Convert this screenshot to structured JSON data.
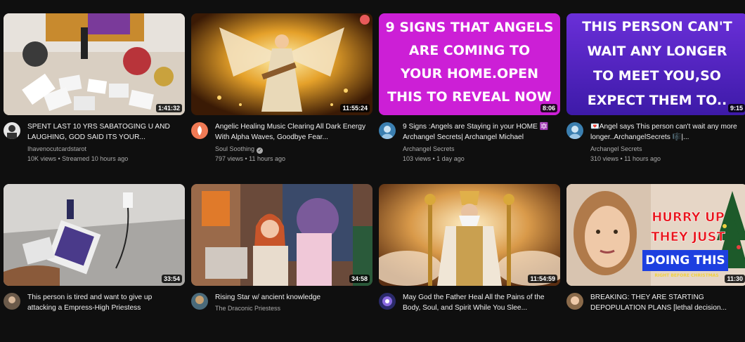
{
  "videos": [
    {
      "title": "SPENT LAST 10 YRS SABATOGING U AND LAUGHING, GOD SAID ITS YOUR...",
      "channel": "Ihavenocutcardstarot",
      "stats": "10K views • Streamed 10 hours ago",
      "duration": "1:41:32",
      "verified": false,
      "thumb_text": ""
    },
    {
      "title": "Angelic Healing Music Clearing All Dark Energy With Alpha Waves, Goodbye Fear...",
      "channel": "Soul Soothing",
      "stats": "797 views • 11 hours ago",
      "duration": "11:55:24",
      "verified": true,
      "thumb_text": ""
    },
    {
      "title": "9 Signs :Angels are Staying in your HOME 🔯 Archangel Secrets| Archangel Michael",
      "channel": "Archangel  Secrets",
      "stats": "103 views • 1 day ago",
      "duration": "8:06",
      "verified": false,
      "thumb_text": "9 SIGNS THAT ANGELS\nARE COMING TO\nYOUR HOME.OPEN\nTHIS TO REVEAL NOW"
    },
    {
      "title": "💌Angel says This person can't wait any more longer..ArchangelSecrets 🎼|...",
      "channel": "Archangel  Secrets",
      "stats": "310 views • 11 hours ago",
      "duration": "9:15",
      "verified": false,
      "thumb_text": "THIS PERSON CAN'T\nWAIT ANY LONGER\nTO MEET YOU,SO\nEXPECT THEM TO.."
    },
    {
      "title": "This person is tired and want to give up attacking a Empress-High Priestess",
      "channel": "",
      "stats": "",
      "duration": "33:54",
      "verified": false,
      "thumb_text": ""
    },
    {
      "title": "Rising Star w/ ancient knowledge",
      "channel": "The Draconic Priestess",
      "stats": "",
      "duration": "34:58",
      "verified": false,
      "thumb_text": ""
    },
    {
      "title": "May God the Father Heal All the Pains of the Body, Soul, and Spirit While You Slee...",
      "channel": "",
      "stats": "",
      "duration": "11:54:59",
      "verified": false,
      "thumb_text": ""
    },
    {
      "title": "BREAKING: THEY ARE STARTING DEPOPULATION PLANS [lethal decision...",
      "channel": "",
      "stats": "",
      "duration": "11:30",
      "verified": false,
      "thumb_text": "HURRY UP\nTHEY JUST\nSTARTED\nDOING THIS",
      "thumb_subtext": "RIGHT BEFORE CHRISTMAS"
    }
  ],
  "icons": {
    "verified": "checkmark-circle-icon"
  },
  "colors": {
    "background": "#0f0f0f",
    "text_primary": "#f1f1f1",
    "text_secondary": "#aaaaaa",
    "thumb3_bg": "#cc1fd6",
    "thumb4_bg": "#5a2ed1",
    "thumb8_red": "#e8141b",
    "thumb8_blue": "#1d3fe0"
  }
}
